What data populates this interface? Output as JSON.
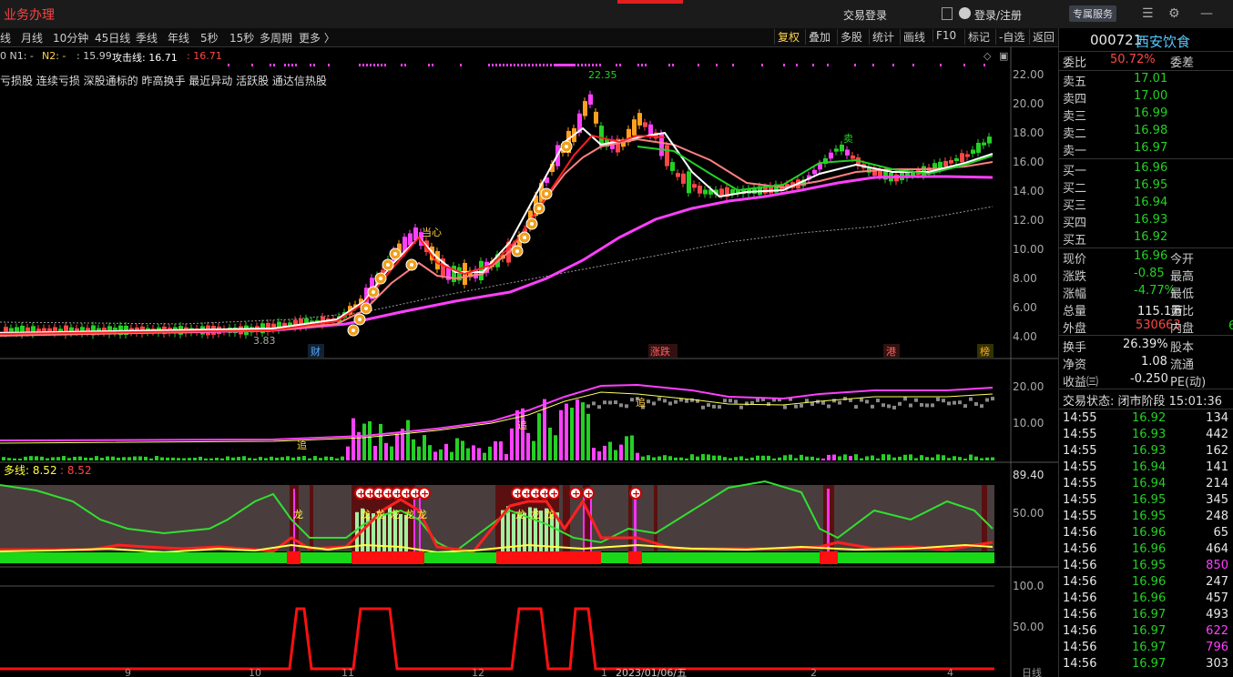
{
  "colors": {
    "up": "#ff4646",
    "down": "#24d024",
    "bg": "#000000",
    "accent": "#ff40ff"
  },
  "topbar": {
    "biz_label": "业务办理",
    "trade_login": "交易登录",
    "login": "登录/注册",
    "vip": "专属服务",
    "icons": [
      "menu-icon",
      "gear-icon",
      "minimize-icon"
    ]
  },
  "periods": [
    "线",
    "月线",
    "10分钟",
    "45日线",
    "季线",
    "年线",
    "5秒",
    "15秒",
    "多周期",
    "更多 〉"
  ],
  "right_buttons": [
    "复权",
    "叠加",
    "多股",
    "统计",
    "画线",
    "F10",
    "标记",
    "-自选",
    "返回"
  ],
  "legend1": {
    "n1": "0  N1: -",
    "n2": "N2: -",
    "n2v": ": 15.99",
    "attack_label": "攻击线: 16.71",
    "attack_val": ": 16.71"
  },
  "tags": "亏损股 连续亏损 深股通标的 昨高换手 最近异动 活跃股 通达信热股",
  "chart_data": {
    "type": "line",
    "price_axis": [
      "22.00",
      "20.00",
      "18.00",
      "16.00",
      "14.00",
      "12.00",
      "10.00",
      "8.00",
      "6.00",
      "4.00"
    ],
    "annotations": {
      "high": "22.35",
      "low": "3.83",
      "xin": "当心",
      "sell": "卖",
      "cai": "财",
      "zhangdie": "涨跌",
      "gang": "港",
      "bang": "榜",
      "zhui": "追"
    },
    "vol_axis": [
      "20.00",
      "10.00"
    ],
    "ind_axis_top": "89.40",
    "ind_axis": [
      "50.00"
    ],
    "ind_label": "多线: 8.52",
    "ind_val": ": 8.52",
    "ind_marks": [
      "龙",
      "龙",
      "龙",
      "龙",
      "龙",
      "龙",
      "龙",
      "龙",
      "龙"
    ],
    "bottom_axis": [
      "100.0",
      "50.00"
    ],
    "x_labels": [
      "9",
      "10",
      "11",
      "12",
      "1",
      "2023/01/06/五",
      "2",
      "4",
      "日线"
    ]
  },
  "quote": {
    "code": "000721",
    "name": "西安饮食",
    "weibi_label": "委比",
    "weibi": "50.72%",
    "weicha_label": "委差",
    "sells": [
      {
        "l": "卖五",
        "p": "17.01"
      },
      {
        "l": "卖四",
        "p": "17.00"
      },
      {
        "l": "卖三",
        "p": "16.99"
      },
      {
        "l": "卖二",
        "p": "16.98"
      },
      {
        "l": "卖一",
        "p": "16.97"
      }
    ],
    "buys": [
      {
        "l": "买一",
        "p": "16.96"
      },
      {
        "l": "买二",
        "p": "16.95"
      },
      {
        "l": "买三",
        "p": "16.94"
      },
      {
        "l": "买四",
        "p": "16.93"
      },
      {
        "l": "买五",
        "p": "16.92"
      }
    ],
    "stats": [
      {
        "l": "现价",
        "v": "16.96",
        "c": "g",
        "l2": "今开"
      },
      {
        "l": "涨跌",
        "v": "-0.85",
        "c": "g",
        "l2": "最高"
      },
      {
        "l": "涨幅",
        "v": "-4.77%",
        "c": "g",
        "l2": "最低"
      },
      {
        "l": "总量",
        "v": "115.1万",
        "c": "w",
        "l2": "量比"
      },
      {
        "l": "外盘",
        "v": "530663",
        "c": "r",
        "l2": "内盘"
      }
    ],
    "inpan_tail": "6",
    "stats2": [
      {
        "l": "换手",
        "v": "26.39%",
        "l2": "股本"
      },
      {
        "l": "净资",
        "v": "1.08",
        "l2": "流通"
      },
      {
        "l": "收益㈢",
        "v": "-0.250",
        "l2": "PE(动)"
      }
    ],
    "status": "交易状态: 闭市阶段 15:01:36",
    "ticks": [
      {
        "t": "14:55",
        "p": "16.92",
        "v": "134"
      },
      {
        "t": "14:55",
        "p": "16.93",
        "v": "442"
      },
      {
        "t": "14:55",
        "p": "16.93",
        "v": "162"
      },
      {
        "t": "14:55",
        "p": "16.94",
        "v": "141"
      },
      {
        "t": "14:55",
        "p": "16.94",
        "v": "214"
      },
      {
        "t": "14:55",
        "p": "16.95",
        "v": "345"
      },
      {
        "t": "14:55",
        "p": "16.95",
        "v": "248"
      },
      {
        "t": "14:56",
        "p": "16.96",
        "v": "65"
      },
      {
        "t": "14:56",
        "p": "16.96",
        "v": "464"
      },
      {
        "t": "14:56",
        "p": "16.95",
        "v": "850"
      },
      {
        "t": "14:56",
        "p": "16.96",
        "v": "247"
      },
      {
        "t": "14:56",
        "p": "16.96",
        "v": "457"
      },
      {
        "t": "14:56",
        "p": "16.97",
        "v": "493"
      },
      {
        "t": "14:56",
        "p": "16.97",
        "v": "622"
      },
      {
        "t": "14:56",
        "p": "16.97",
        "v": "796"
      },
      {
        "t": "14:56",
        "p": "16.97",
        "v": "303"
      }
    ]
  }
}
